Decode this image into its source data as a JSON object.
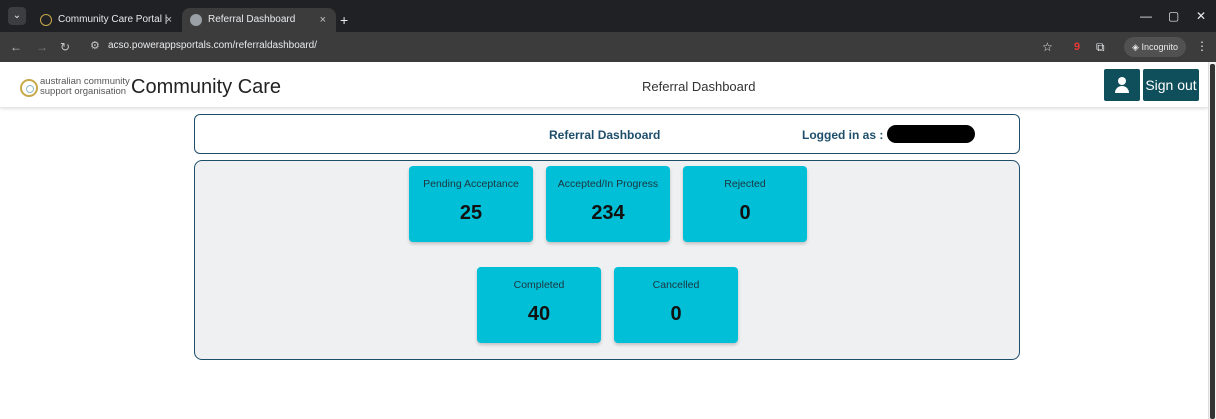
{
  "browser": {
    "tabs": [
      {
        "title": "Community Care Portal | ACSO",
        "active": false
      },
      {
        "title": "Referral Dashboard",
        "active": true
      }
    ],
    "close_glyph": "×",
    "new_tab_glyph": "+",
    "url": "acso.powerappsportals.com/referraldashboard/",
    "incognito_label": "Incognito",
    "extension_badge": "9"
  },
  "header": {
    "logo_line1": "australian community",
    "logo_line2": "support organisation",
    "brand": "Community Care",
    "title": "Referral Dashboard",
    "sign_out": "Sign out"
  },
  "info": {
    "title": "Referral Dashboard",
    "logged_in_label": "Logged in as :"
  },
  "cards": [
    {
      "label": "Pending Acceptance",
      "value": "25"
    },
    {
      "label": "Accepted/In Progress",
      "value": "234"
    },
    {
      "label": "Rejected",
      "value": "0"
    },
    {
      "label": "Completed",
      "value": "40"
    },
    {
      "label": "Cancelled",
      "value": "0"
    }
  ],
  "colors": {
    "card": "#00bfd6",
    "accent": "#0f4f5c",
    "border": "#1f4e6b"
  }
}
